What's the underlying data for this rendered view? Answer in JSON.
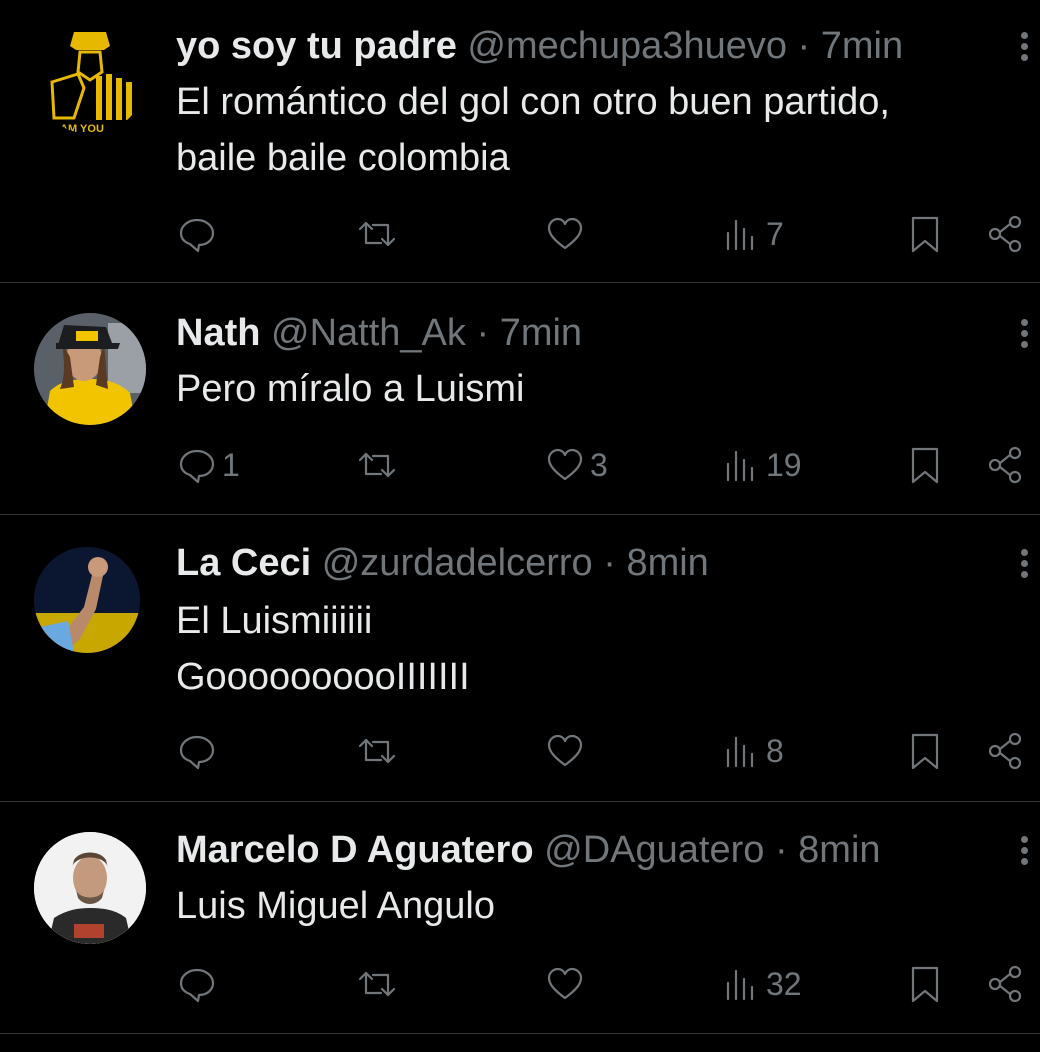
{
  "tweets": [
    {
      "name": "yo soy tu padre",
      "handle": "@mechupa3huevo",
      "sep": "·",
      "time": "7min",
      "lines": [
        "El romántico del gol con otro buen partido,",
        "baile baile colombia"
      ],
      "avatar_text": "AM YOU",
      "replies": "",
      "retweets": "",
      "likes": "",
      "views": "7"
    },
    {
      "name": "Nath",
      "handle": "@Natth_Ak",
      "sep": "·",
      "time": "7min",
      "lines": [
        "Pero míralo a Luismi"
      ],
      "replies": "1",
      "retweets": "",
      "likes": "3",
      "views": "19"
    },
    {
      "name": "La Ceci",
      "handle": "@zurdadelcerro",
      "sep": "·",
      "time": "8min",
      "lines": [
        "El Luismiiiiii",
        "GoooooooooIIIIIII"
      ],
      "replies": "",
      "retweets": "",
      "likes": "",
      "views": "8"
    },
    {
      "name": "Marcelo D Aguatero",
      "handle": "@DAguatero",
      "sep": "·",
      "time": "8min",
      "lines": [
        "Luis Miguel Angulo"
      ],
      "replies": "",
      "retweets": "",
      "likes": "",
      "views": "32"
    }
  ],
  "colors": {
    "background": "#000000",
    "text": "#e7e9ea",
    "muted": "#71767b",
    "divider": "#2f3336"
  },
  "icons": [
    "reply-icon",
    "retweet-icon",
    "like-icon",
    "views-icon",
    "bookmark-icon",
    "share-icon",
    "more-icon"
  ]
}
